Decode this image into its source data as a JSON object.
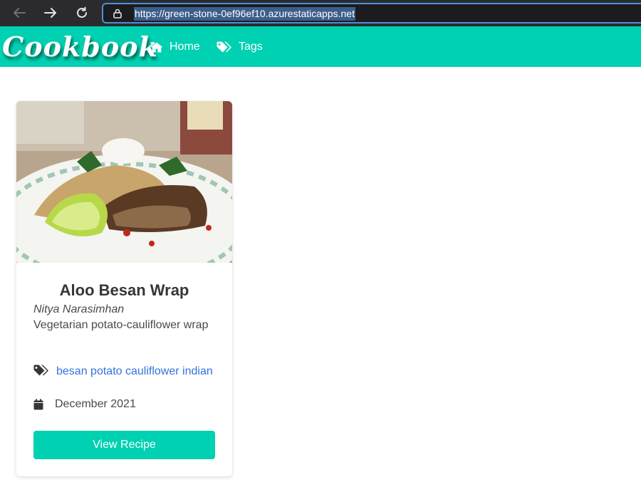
{
  "browser": {
    "url": "https://green-stone-0ef96ef10.azurestaticapps.net",
    "icons": [
      "back-arrow-icon",
      "forward-arrow-icon",
      "reload-icon",
      "lock-icon"
    ]
  },
  "navbar": {
    "brand": "Cookbook",
    "items": [
      {
        "label": "Home",
        "icon": "home-icon"
      },
      {
        "label": "Tags",
        "icon": "tags-icon"
      }
    ],
    "color": "#00d1b2"
  },
  "recipe_card": {
    "title": "Aloo Besan Wrap",
    "author": "Nitya Narasimhan",
    "description": "Vegetarian potato-cauliflower wrap",
    "tags": [
      "besan",
      "potato",
      "cauliflower",
      "indian"
    ],
    "date": "December 2021",
    "button_label": "View Recipe",
    "image_icon": "food-photo",
    "link_color": "#3273dc"
  }
}
